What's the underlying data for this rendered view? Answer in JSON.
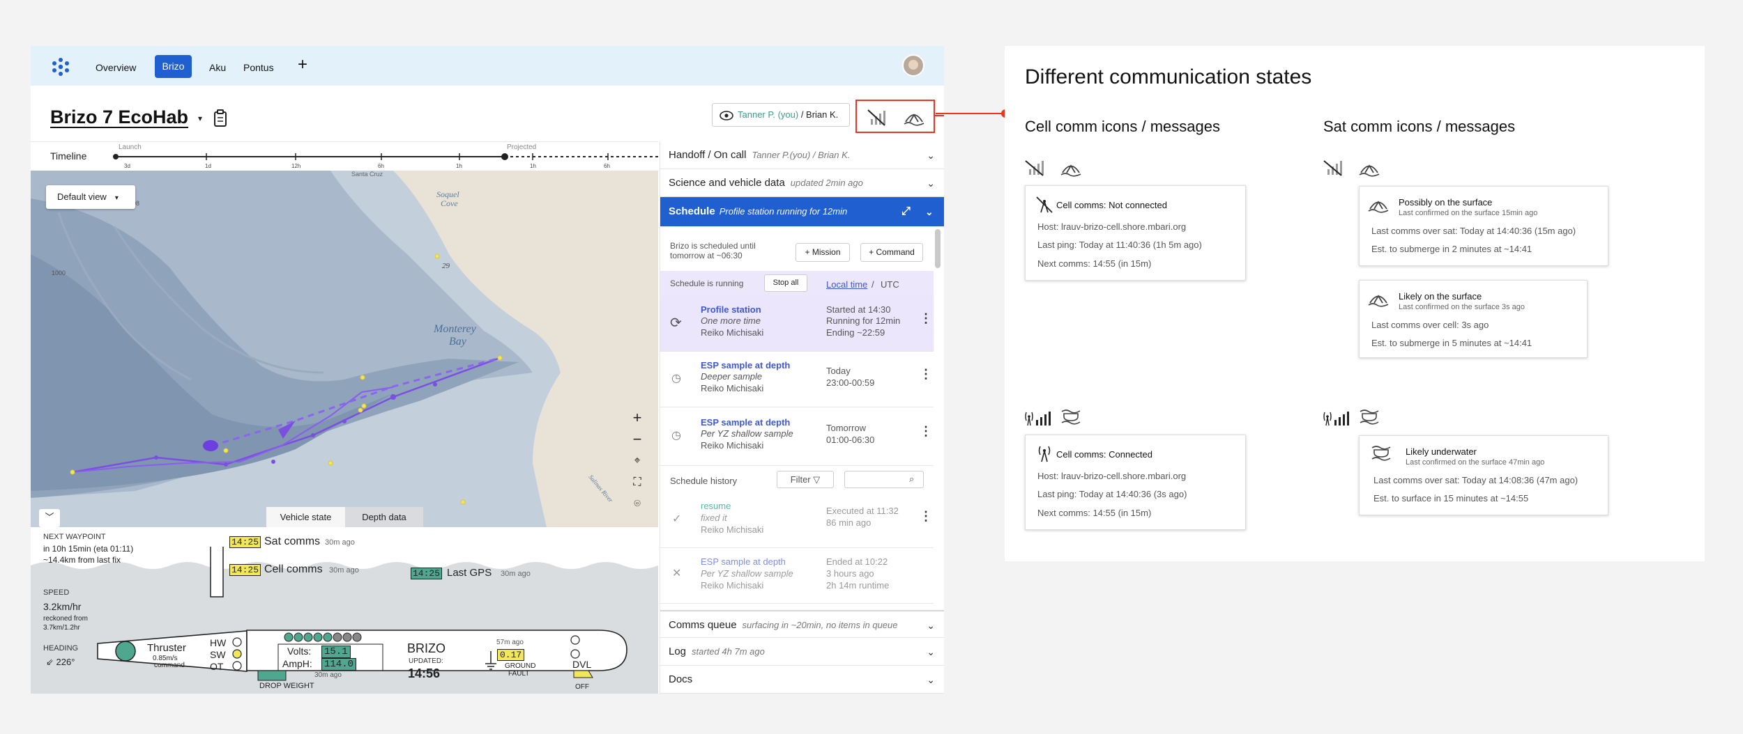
{
  "nav": {
    "items": [
      "Overview",
      "Brizo",
      "Aku",
      "Pontus"
    ],
    "add": "+"
  },
  "vehicle": {
    "title": "Brizo 7 EcoHab"
  },
  "oncall": {
    "primary": "Tanner P. (you)",
    "separator": " / ",
    "secondary": "Brian K."
  },
  "timeline": {
    "label": "Timeline",
    "launch": "Launch",
    "projected": "Projected",
    "ticks": [
      "3d",
      "1d",
      "12h",
      "6h",
      "1h",
      "1h",
      "6h"
    ]
  },
  "map": {
    "view": "Default view",
    "labels": {
      "bay": "Monterey",
      "bay2": "Bay",
      "cove": "Soquel",
      "cove2": "Cove",
      "num29": "29",
      "santacruz": "Santa Cruz",
      "salinas": "Salinas River",
      "l98": "98",
      "l1000": "1000"
    },
    "tabs": [
      "Vehicle state",
      "Depth data"
    ]
  },
  "state": {
    "next_waypoint_label": "NEXT WAYPOINT",
    "next_waypoint_1": "in 10h 15min (eta 01:11)",
    "next_waypoint_2": "~14.4km from last fix",
    "speed_label": "SPEED",
    "speed": "3.2km/hr",
    "speed_note1": "reckoned from",
    "speed_note2": "3.7km/1.2hr",
    "heading_label": "HEADING",
    "heading": "226°",
    "sat_time": "14:25",
    "sat_label": "Sat comms",
    "sat_ago": "30m ago",
    "cell_time": "14:25",
    "cell_label": "Cell comms",
    "cell_ago": "30m ago",
    "gps_time": "14:25",
    "gps_label": "Last GPS",
    "gps_ago": "30m ago",
    "thruster": "Thruster",
    "thruster_speed": "0.85m/s",
    "thruster_cmd": "command",
    "hw": "HW",
    "sw": "SW",
    "ot": "OT",
    "volts_label": "Volts:",
    "volts": "15.1",
    "amph_label": "AmpH:",
    "amph": "114.0",
    "batt_ago": "30m ago",
    "name": "BRIZO",
    "updated_label": "UPDATED:",
    "updated": "14:56",
    "gf_ago": "57m ago",
    "gf": "0.17",
    "gf_label1": "GROUND",
    "gf_label2": "FAULT",
    "dvl": "DVL",
    "dvl_state": "OFF",
    "drop": "DROP WEIGHT"
  },
  "right": {
    "handoff": {
      "label": "Handoff / On call",
      "sub": "Tanner P.(you) / Brian K."
    },
    "science": {
      "label": "Science and vehicle data",
      "sub": "updated 2min ago"
    },
    "schedule": {
      "label": "Schedule",
      "sub": "Profile station running for 12min"
    },
    "sched_until1": "Brizo is scheduled until",
    "sched_until2": "tomorrow at ~06:30",
    "mission_btn": "Mission",
    "command_btn": "Command",
    "running": "Schedule is running",
    "stop_all": "Stop all",
    "local": "Local time",
    "slash": " / ",
    "utc": "UTC",
    "rows": [
      {
        "title": "Profile station",
        "sub": "One more time",
        "name": "Reiko Michisaki",
        "c1": "Started at 14:30",
        "c2": "Running for 12min",
        "c3": "Ending ~22:59"
      },
      {
        "title": "ESP sample at depth",
        "sub": "Deeper sample",
        "name": "Reiko Michisaki",
        "c1": "Today",
        "c2": "23:00-00:59"
      },
      {
        "title": "ESP sample at depth",
        "sub": "Per YZ shallow sample",
        "name": "Reiko Michisaki",
        "c1": "Tomorrow",
        "c2": "01:00-06:30"
      }
    ],
    "history": "Schedule history",
    "filter": "Filter",
    "hist": [
      {
        "title": "resume",
        "sub": "fixed it",
        "name": "Reiko Michisaki",
        "c1": "Executed at 11:32",
        "c2": "86 min ago"
      },
      {
        "title": "ESP sample at depth",
        "sub": "Per YZ shallow sample",
        "name": "Reiko Michisaki",
        "c1": "Ended at 10:22",
        "c2": "3 hours ago",
        "c3": "2h 14m runtime"
      }
    ],
    "comms": {
      "label": "Comms queue",
      "sub": "surfacing in ~20min, no items in queue"
    },
    "log": {
      "label": "Log",
      "sub": "started 4h 7m ago"
    },
    "docs": {
      "label": "Docs"
    }
  },
  "panel": {
    "title": "Different communication states",
    "cell_heading": "Cell comm icons / messages",
    "sat_heading": "Sat comm icons / messages",
    "cell_nc": {
      "title": "Cell comms: Not connected",
      "host": "Host: lrauv-brizo-cell.shore.mbari.org",
      "ping": "Last ping: Today at 11:40:36 (1h 5m ago)",
      "next": "Next comms: 14:55 (in 15m)"
    },
    "cell_c": {
      "title": "Cell comms: Connected",
      "host": "Host: lrauv-brizo-cell.shore.mbari.org",
      "ping": "Last ping: Today at 14:40:36 (3s ago)",
      "next": "Next comms: 14:55 (in 15m)"
    },
    "sat_possibly": {
      "title": "Possibly on the surface",
      "sub": "Last confirmed on the surface 15min ago",
      "l1": "Last comms over sat: Today at 14:40:36 (15m ago)",
      "l2": "Est. to submerge in 2 minutes at ~14:41"
    },
    "sat_likely": {
      "title": "Likely on the surface",
      "sub": "Last confirmed on the surface 3s ago",
      "l1": "Last comms over cell: 3s ago",
      "l2": "Est. to submerge in 5 minutes at ~14:41"
    },
    "sat_under": {
      "title": "Likely underwater",
      "sub": "Last confirmed on the surface 47min ago",
      "l1": "Last comms over sat: Today at 14:08:36 (47m ago)",
      "l2": "Est. to surface in 15 minutes at ~14:55"
    }
  }
}
